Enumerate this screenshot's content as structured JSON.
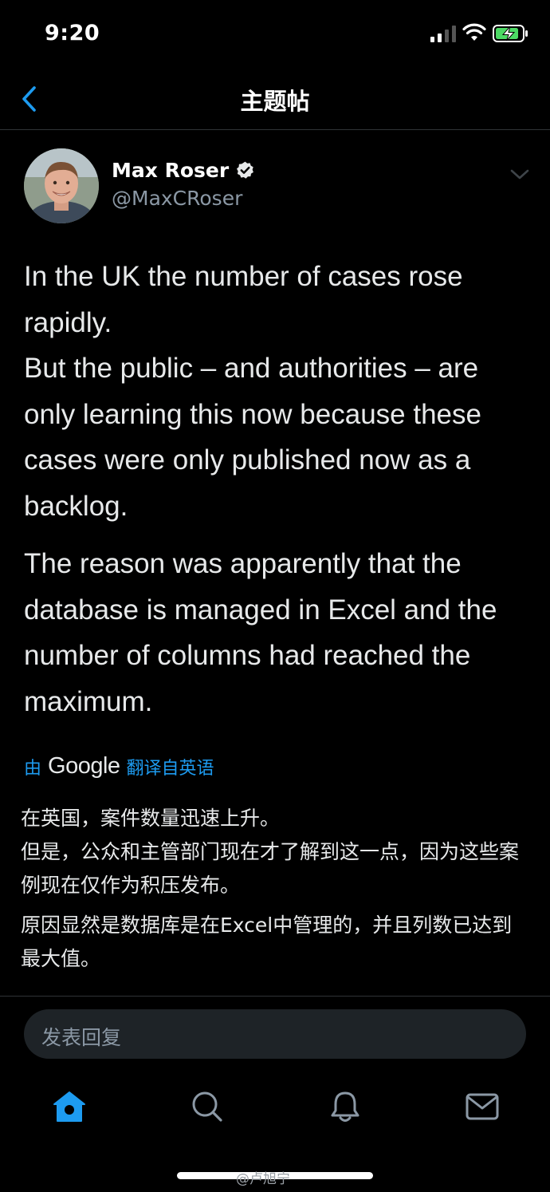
{
  "status_bar": {
    "time": "9:20",
    "battery_charging": true
  },
  "nav": {
    "title": "主题帖",
    "back_icon": "chevron-left-icon"
  },
  "tweet": {
    "author_name": "Max Roser",
    "handle": "@MaxCRoser",
    "verified": true,
    "paragraph_1": "In the UK the number of cases rose rapidly.\nBut the public – and authorities – are only learning this now because these cases were only published now as a backlog.",
    "paragraph_2": "The reason was apparently that the database is managed in Excel and the number of columns had reached the maximum."
  },
  "translation": {
    "by": "由",
    "provider": "Google",
    "label": "翻译自英语",
    "paragraph_1": "在英国，案件数量迅速上升。\n但是，公众和主管部门现在才了解到这一点，因为这些案例现在仅作为积压发布。",
    "paragraph_2": "原因显然是数据库是在Excel中管理的，并且列数已达到最大值。"
  },
  "reply": {
    "placeholder": "发表回复"
  },
  "tabs": [
    {
      "name": "home",
      "icon": "home-icon",
      "active": true
    },
    {
      "name": "search",
      "icon": "search-icon",
      "active": false
    },
    {
      "name": "notifications",
      "icon": "bell-icon",
      "active": false
    },
    {
      "name": "messages",
      "icon": "mail-icon",
      "active": false
    }
  ],
  "watermark": "@卢旭宁",
  "colors": {
    "accent": "#1d9bf0",
    "background": "#000000",
    "secondary_text": "#8b98a5"
  }
}
